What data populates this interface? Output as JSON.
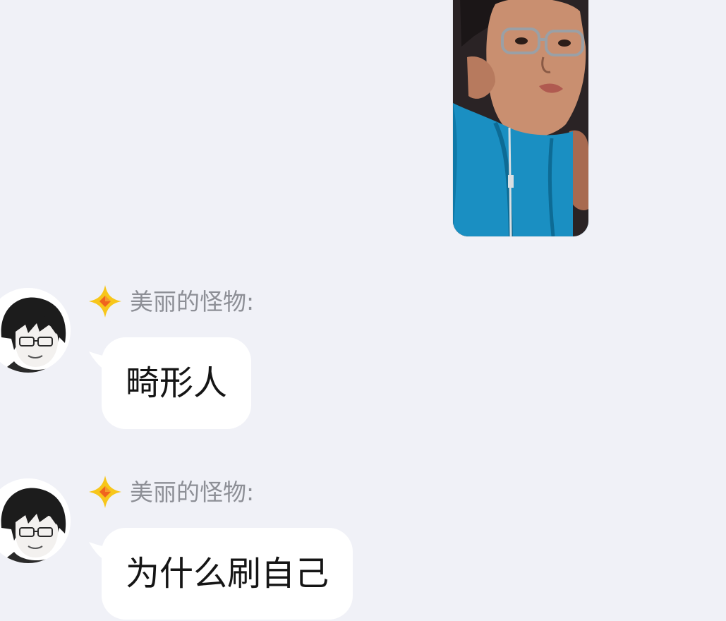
{
  "shared_image": {
    "icon": "photo-of-boy-in-blue-jacket"
  },
  "messages": [
    {
      "sender": "美丽的怪物:",
      "text": "畸形人",
      "avatar_icon": "anime-boy-with-glasses-avatar",
      "badge_icon": "yellow-diamond-rank-icon"
    },
    {
      "sender": "美丽的怪物:",
      "text": "为什么刷自己",
      "avatar_icon": "anime-boy-with-glasses-avatar",
      "badge_icon": "yellow-diamond-rank-icon"
    }
  ],
  "colors": {
    "background": "#f0f1f7",
    "bubble": "#ffffff",
    "sender_name": "#8d8f96",
    "message_text": "#151515",
    "badge_yellow": "#f7c61a",
    "badge_orange": "#f0641e"
  }
}
